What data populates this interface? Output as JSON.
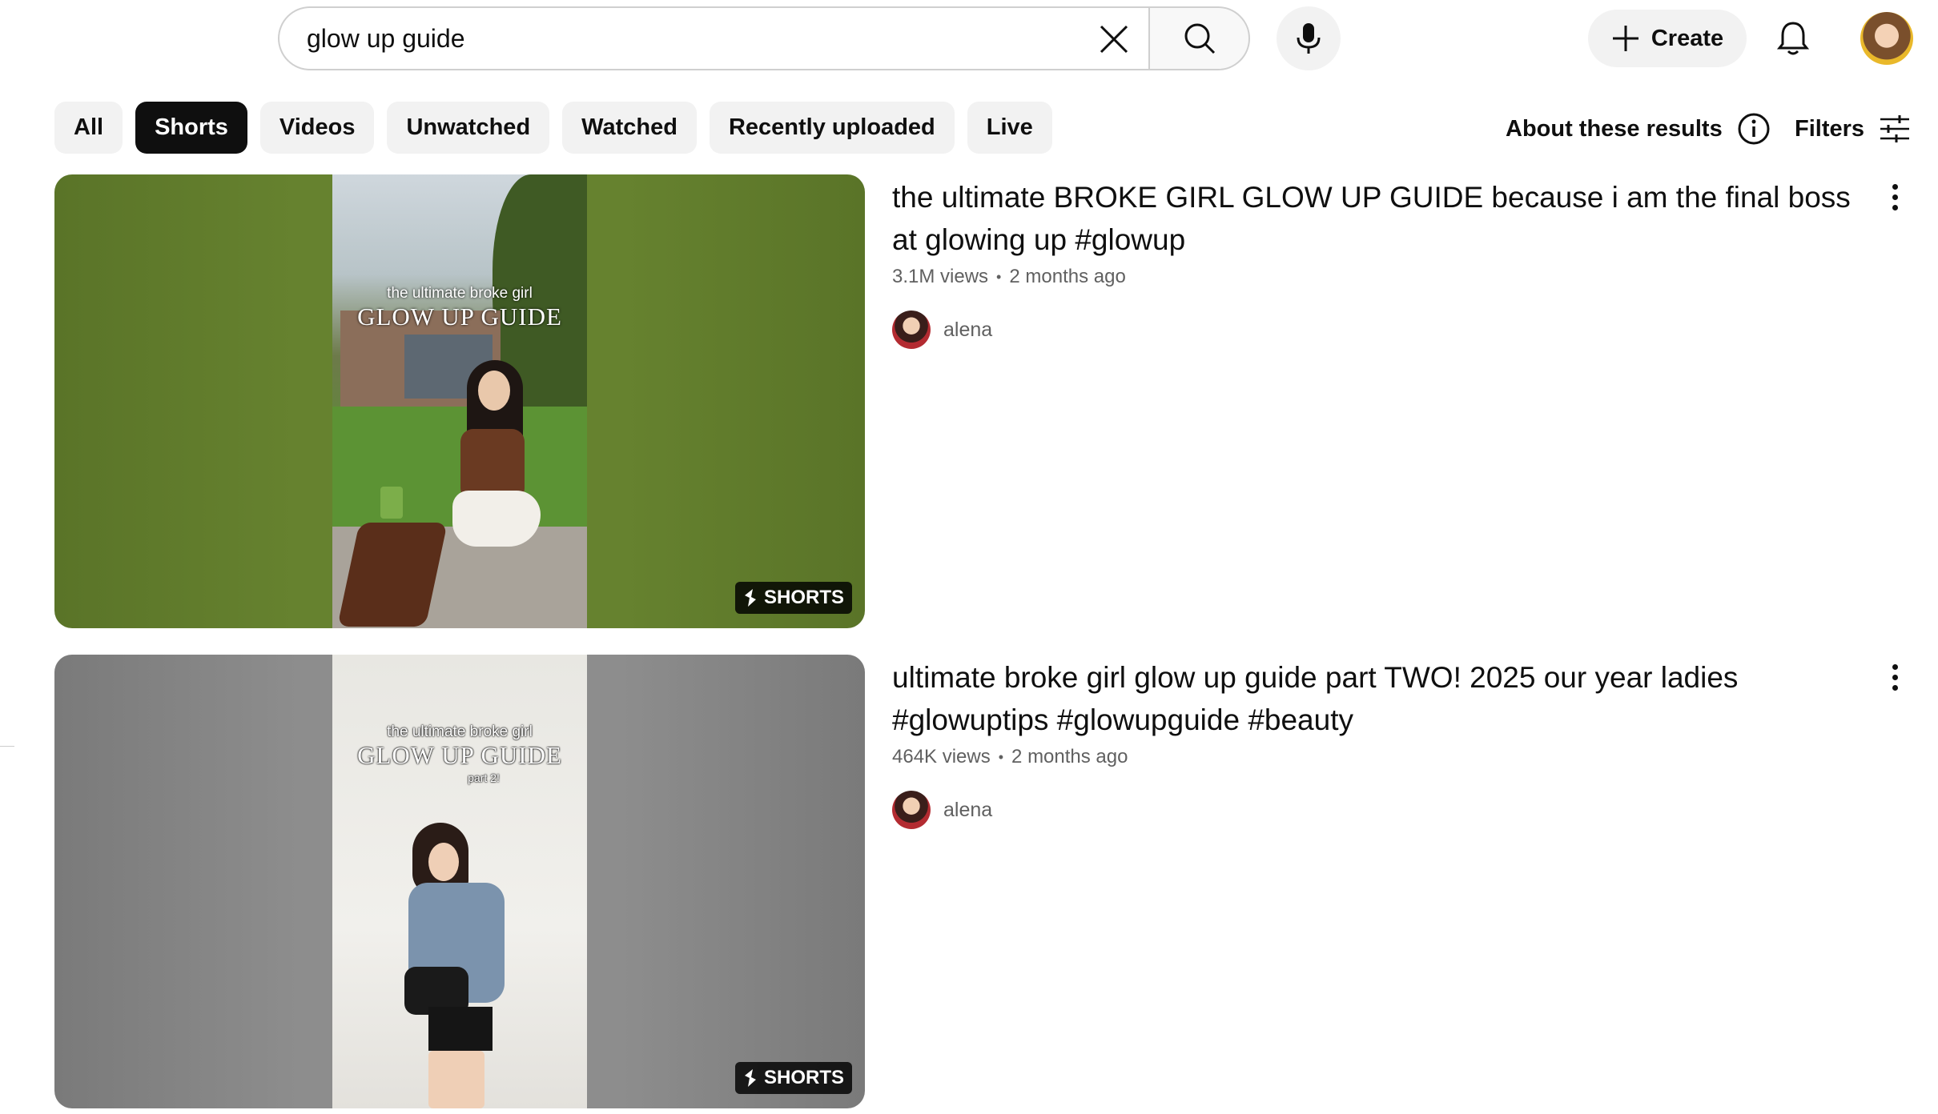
{
  "search": {
    "value": "glow up guide",
    "clear_icon": "close-icon",
    "search_icon": "search-icon",
    "mic_icon": "microphone-icon"
  },
  "header": {
    "create_label": "Create",
    "bell_icon": "bell-icon"
  },
  "chips": [
    {
      "label": "All",
      "active": false
    },
    {
      "label": "Shorts",
      "active": true
    },
    {
      "label": "Videos",
      "active": false
    },
    {
      "label": "Unwatched",
      "active": false
    },
    {
      "label": "Watched",
      "active": false
    },
    {
      "label": "Recently uploaded",
      "active": false
    },
    {
      "label": "Live",
      "active": false
    }
  ],
  "about_label": "About these results",
  "filters_label": "Filters",
  "results": [
    {
      "title": "the ultimate BROKE GIRL GLOW UP GUIDE because i am the final boss at glowing up #glowup",
      "views": "3.1M views",
      "age": "2 months ago",
      "channel": "alena",
      "badge": "SHORTS",
      "thumb_text_1": "the ultimate broke girl",
      "thumb_text_2": "GLOW UP GUIDE",
      "colors": {
        "side": "#5f7a2c",
        "frame": "#6f8a3e"
      }
    },
    {
      "title": "ultimate broke girl glow up guide part TWO! 2025 our year ladies #glowuptips #glowupguide #beauty",
      "views": "464K views",
      "age": "2 months ago",
      "channel": "alena",
      "badge": "SHORTS",
      "thumb_text_1": "the ultimate broke girl",
      "thumb_text_2": "GLOW UP GUIDE",
      "thumb_text_3": "part 2!",
      "colors": {
        "side": "#8e8e8e",
        "frame": "#ecebe6"
      }
    }
  ]
}
